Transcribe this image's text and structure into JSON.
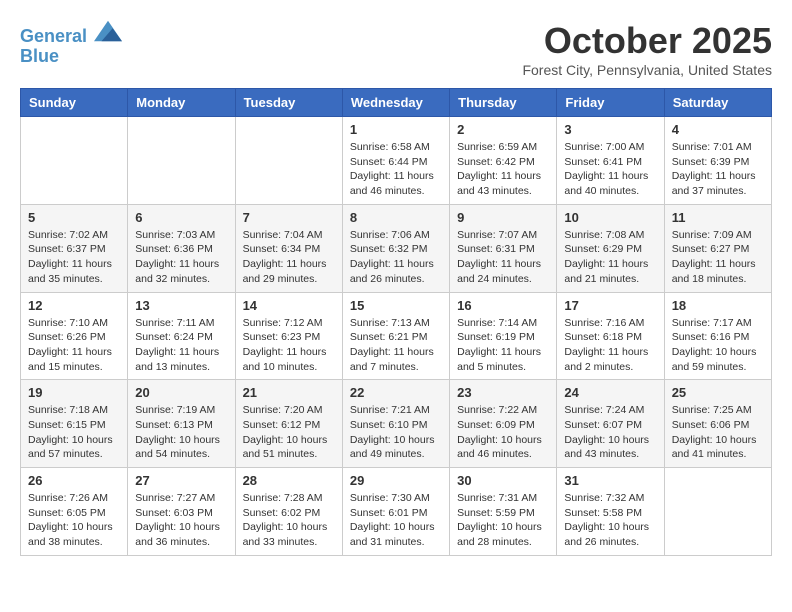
{
  "header": {
    "logo_line1": "General",
    "logo_line2": "Blue",
    "month": "October 2025",
    "location": "Forest City, Pennsylvania, United States"
  },
  "weekdays": [
    "Sunday",
    "Monday",
    "Tuesday",
    "Wednesday",
    "Thursday",
    "Friday",
    "Saturday"
  ],
  "weeks": [
    [
      {
        "day": "",
        "info": ""
      },
      {
        "day": "",
        "info": ""
      },
      {
        "day": "",
        "info": ""
      },
      {
        "day": "1",
        "info": "Sunrise: 6:58 AM\nSunset: 6:44 PM\nDaylight: 11 hours and 46 minutes."
      },
      {
        "day": "2",
        "info": "Sunrise: 6:59 AM\nSunset: 6:42 PM\nDaylight: 11 hours and 43 minutes."
      },
      {
        "day": "3",
        "info": "Sunrise: 7:00 AM\nSunset: 6:41 PM\nDaylight: 11 hours and 40 minutes."
      },
      {
        "day": "4",
        "info": "Sunrise: 7:01 AM\nSunset: 6:39 PM\nDaylight: 11 hours and 37 minutes."
      }
    ],
    [
      {
        "day": "5",
        "info": "Sunrise: 7:02 AM\nSunset: 6:37 PM\nDaylight: 11 hours and 35 minutes."
      },
      {
        "day": "6",
        "info": "Sunrise: 7:03 AM\nSunset: 6:36 PM\nDaylight: 11 hours and 32 minutes."
      },
      {
        "day": "7",
        "info": "Sunrise: 7:04 AM\nSunset: 6:34 PM\nDaylight: 11 hours and 29 minutes."
      },
      {
        "day": "8",
        "info": "Sunrise: 7:06 AM\nSunset: 6:32 PM\nDaylight: 11 hours and 26 minutes."
      },
      {
        "day": "9",
        "info": "Sunrise: 7:07 AM\nSunset: 6:31 PM\nDaylight: 11 hours and 24 minutes."
      },
      {
        "day": "10",
        "info": "Sunrise: 7:08 AM\nSunset: 6:29 PM\nDaylight: 11 hours and 21 minutes."
      },
      {
        "day": "11",
        "info": "Sunrise: 7:09 AM\nSunset: 6:27 PM\nDaylight: 11 hours and 18 minutes."
      }
    ],
    [
      {
        "day": "12",
        "info": "Sunrise: 7:10 AM\nSunset: 6:26 PM\nDaylight: 11 hours and 15 minutes."
      },
      {
        "day": "13",
        "info": "Sunrise: 7:11 AM\nSunset: 6:24 PM\nDaylight: 11 hours and 13 minutes."
      },
      {
        "day": "14",
        "info": "Sunrise: 7:12 AM\nSunset: 6:23 PM\nDaylight: 11 hours and 10 minutes."
      },
      {
        "day": "15",
        "info": "Sunrise: 7:13 AM\nSunset: 6:21 PM\nDaylight: 11 hours and 7 minutes."
      },
      {
        "day": "16",
        "info": "Sunrise: 7:14 AM\nSunset: 6:19 PM\nDaylight: 11 hours and 5 minutes."
      },
      {
        "day": "17",
        "info": "Sunrise: 7:16 AM\nSunset: 6:18 PM\nDaylight: 11 hours and 2 minutes."
      },
      {
        "day": "18",
        "info": "Sunrise: 7:17 AM\nSunset: 6:16 PM\nDaylight: 10 hours and 59 minutes."
      }
    ],
    [
      {
        "day": "19",
        "info": "Sunrise: 7:18 AM\nSunset: 6:15 PM\nDaylight: 10 hours and 57 minutes."
      },
      {
        "day": "20",
        "info": "Sunrise: 7:19 AM\nSunset: 6:13 PM\nDaylight: 10 hours and 54 minutes."
      },
      {
        "day": "21",
        "info": "Sunrise: 7:20 AM\nSunset: 6:12 PM\nDaylight: 10 hours and 51 minutes."
      },
      {
        "day": "22",
        "info": "Sunrise: 7:21 AM\nSunset: 6:10 PM\nDaylight: 10 hours and 49 minutes."
      },
      {
        "day": "23",
        "info": "Sunrise: 7:22 AM\nSunset: 6:09 PM\nDaylight: 10 hours and 46 minutes."
      },
      {
        "day": "24",
        "info": "Sunrise: 7:24 AM\nSunset: 6:07 PM\nDaylight: 10 hours and 43 minutes."
      },
      {
        "day": "25",
        "info": "Sunrise: 7:25 AM\nSunset: 6:06 PM\nDaylight: 10 hours and 41 minutes."
      }
    ],
    [
      {
        "day": "26",
        "info": "Sunrise: 7:26 AM\nSunset: 6:05 PM\nDaylight: 10 hours and 38 minutes."
      },
      {
        "day": "27",
        "info": "Sunrise: 7:27 AM\nSunset: 6:03 PM\nDaylight: 10 hours and 36 minutes."
      },
      {
        "day": "28",
        "info": "Sunrise: 7:28 AM\nSunset: 6:02 PM\nDaylight: 10 hours and 33 minutes."
      },
      {
        "day": "29",
        "info": "Sunrise: 7:30 AM\nSunset: 6:01 PM\nDaylight: 10 hours and 31 minutes."
      },
      {
        "day": "30",
        "info": "Sunrise: 7:31 AM\nSunset: 5:59 PM\nDaylight: 10 hours and 28 minutes."
      },
      {
        "day": "31",
        "info": "Sunrise: 7:32 AM\nSunset: 5:58 PM\nDaylight: 10 hours and 26 minutes."
      },
      {
        "day": "",
        "info": ""
      }
    ]
  ]
}
